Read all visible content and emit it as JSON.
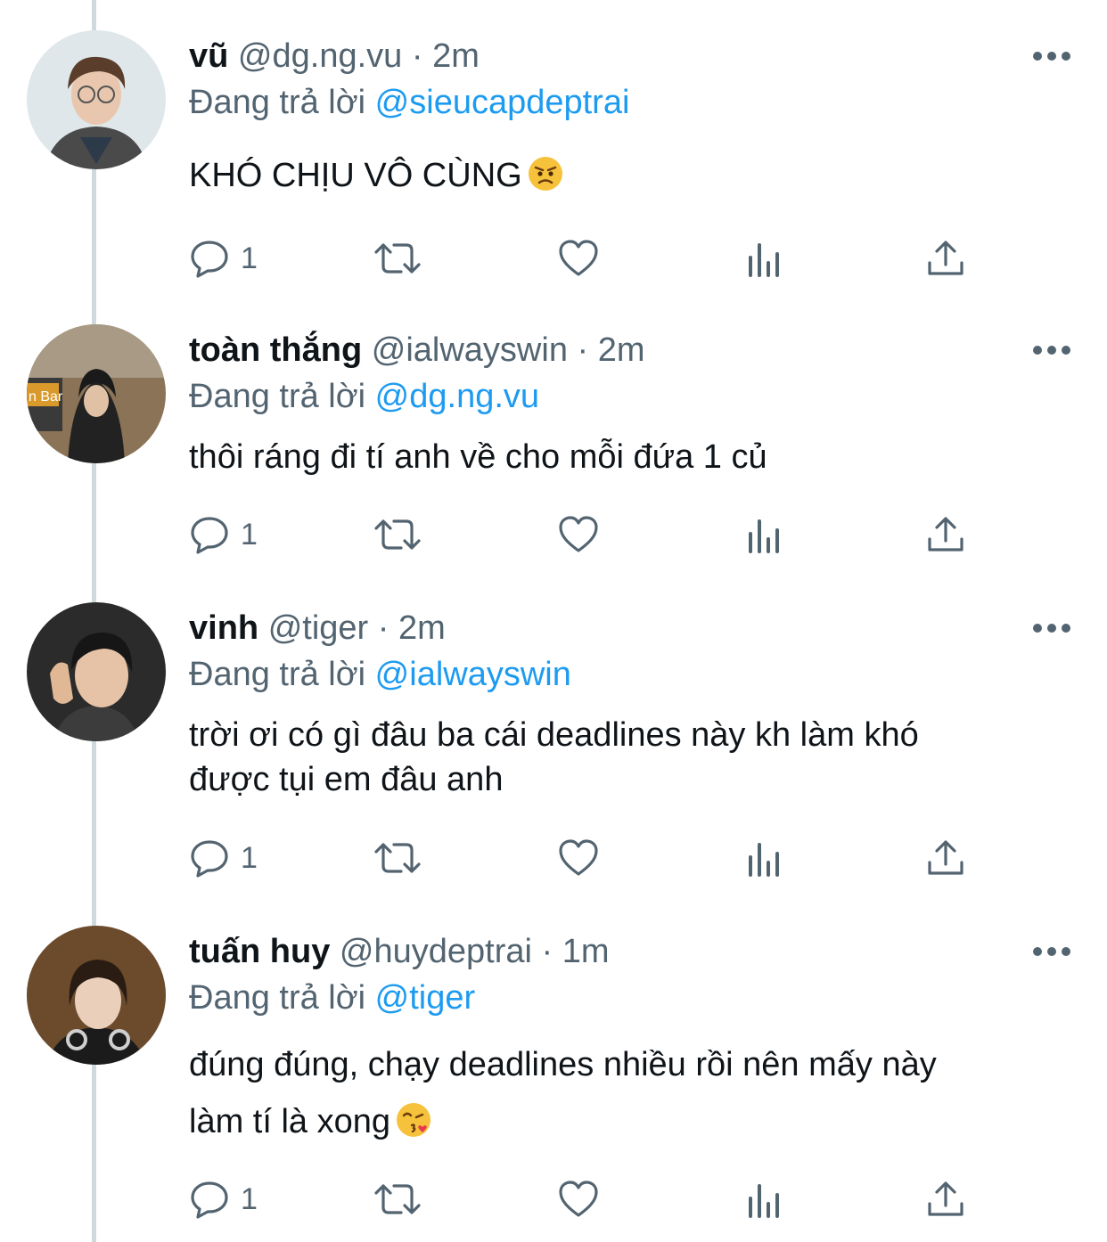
{
  "tweets": [
    {
      "name": "vũ",
      "handle": "@dg.ng.vu",
      "time": "2m",
      "reply_prefix": "Đang trả lời",
      "reply_to": "@sieucapdeptrai",
      "lines": [
        "KHÓ CHỊU VÔ CÙNG"
      ],
      "emoji": "angry-face",
      "reply_count": "1"
    },
    {
      "name": "toàn thắng",
      "handle": "@ialwayswin",
      "time": "2m",
      "reply_prefix": "Đang trả lời",
      "reply_to": "@dg.ng.vu",
      "lines": [
        "thôi ráng đi tí anh về cho mỗi đứa 1 củ"
      ],
      "emoji": "",
      "reply_count": "1"
    },
    {
      "name": "vinh",
      "handle": "@tiger",
      "time": "2m",
      "reply_prefix": "Đang trả lời",
      "reply_to": "@ialwayswin",
      "lines": [
        "trời ơi có gì đâu ba cái deadlines này kh làm khó",
        "được tụi em đâu anh"
      ],
      "emoji": "",
      "reply_count": "1"
    },
    {
      "name": "tuấn huy",
      "handle": "@huydeptrai",
      "time": "1m",
      "reply_prefix": "Đang trả lời",
      "reply_to": "@tiger",
      "lines": [
        "đúng đúng, chạy deadlines nhiều rồi nên mấy này",
        "làm tí là xong"
      ],
      "emoji": "face-blowing-kiss",
      "reply_count": "1"
    }
  ],
  "separator": "·",
  "icons": {
    "reply": "speech-bubble-icon",
    "retweet": "retweet-icon",
    "like": "heart-icon",
    "analytics": "bar-chart-icon",
    "share": "share-upload-icon",
    "more": "more-dots-icon"
  },
  "colors": {
    "text": "#0f1419",
    "secondary": "#536471",
    "mention": "#1d9bf0",
    "thread_line": "#cfd9de"
  }
}
